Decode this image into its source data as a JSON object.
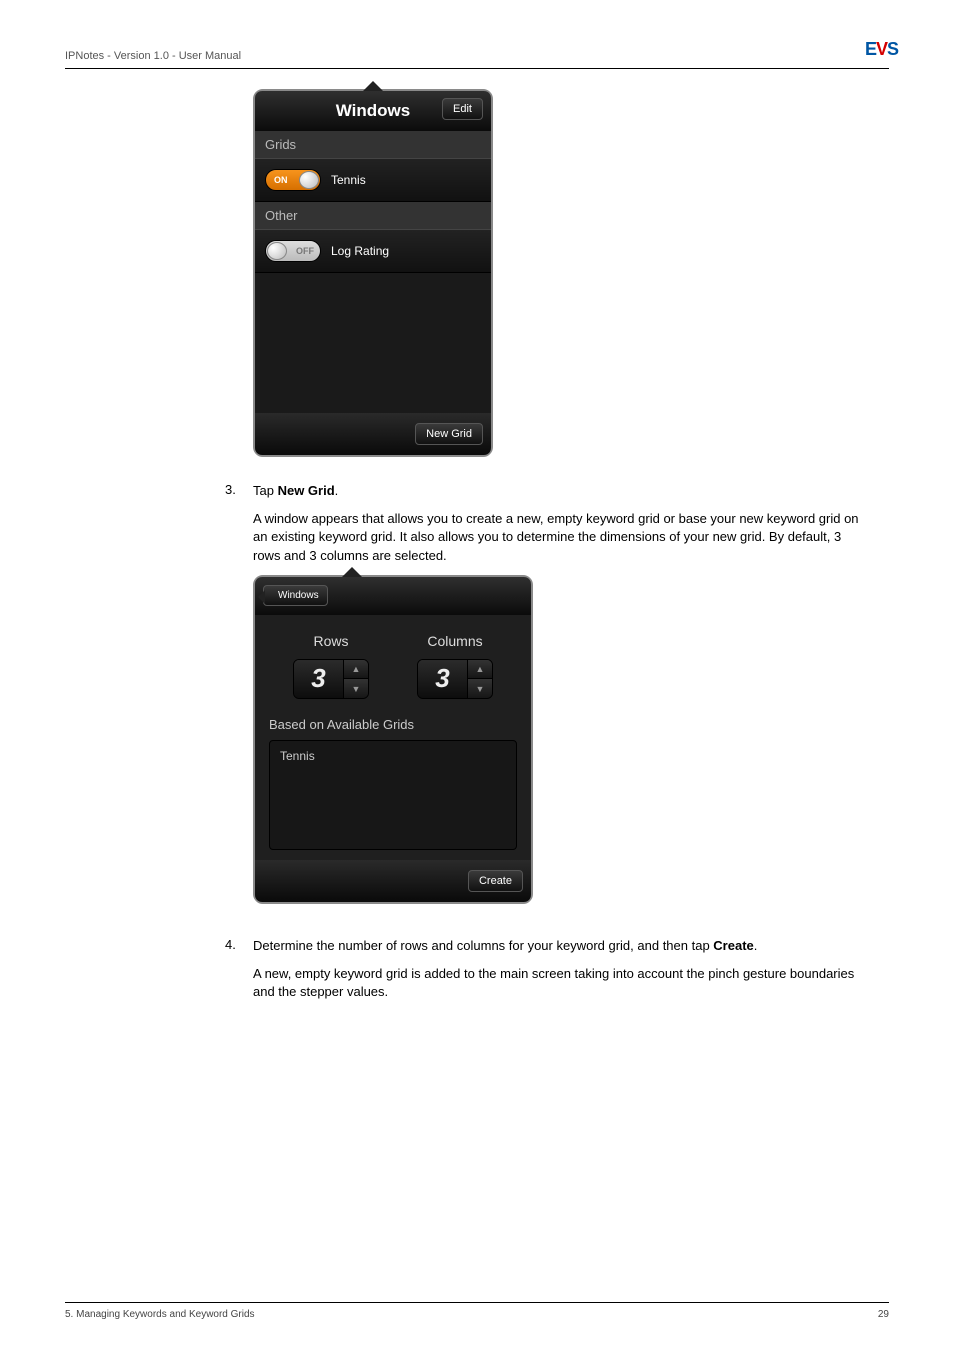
{
  "header": {
    "doc_title": "IPNotes - Version 1.0 - User Manual"
  },
  "popover1": {
    "title": "Windows",
    "edit_label": "Edit",
    "section_grids": "Grids",
    "section_other": "Other",
    "switch_on": "ON",
    "switch_off": "OFF",
    "item_tennis": "Tennis",
    "item_lograting": "Log Rating",
    "new_grid_label": "New Grid"
  },
  "step3": {
    "num": "3.",
    "line1_pre": "Tap ",
    "line1_bold": "New Grid",
    "line1_post": ".",
    "para": "A window appears that allows you to create a new, empty keyword grid or base your new keyword grid on an existing keyword grid. It also allows you to determine the dimensions of your new grid. By default, 3 rows and 3 columns are selected."
  },
  "popover2": {
    "back_label": "Windows",
    "rows_label": "Rows",
    "cols_label": "Columns",
    "rows_value": "3",
    "cols_value": "3",
    "based_label": "Based on Available Grids",
    "grid_item": "Tennis",
    "create_label": "Create"
  },
  "step4": {
    "num": "4.",
    "line1_pre": "Determine the number of rows and columns for your keyword grid, and then tap ",
    "line1_bold": "Create",
    "line1_post": ".",
    "para": "A new, empty keyword grid is added to the main screen taking into account the pinch gesture boundaries and the stepper values."
  },
  "footer": {
    "section": "5. Managing Keywords and Keyword Grids",
    "page": "29"
  }
}
